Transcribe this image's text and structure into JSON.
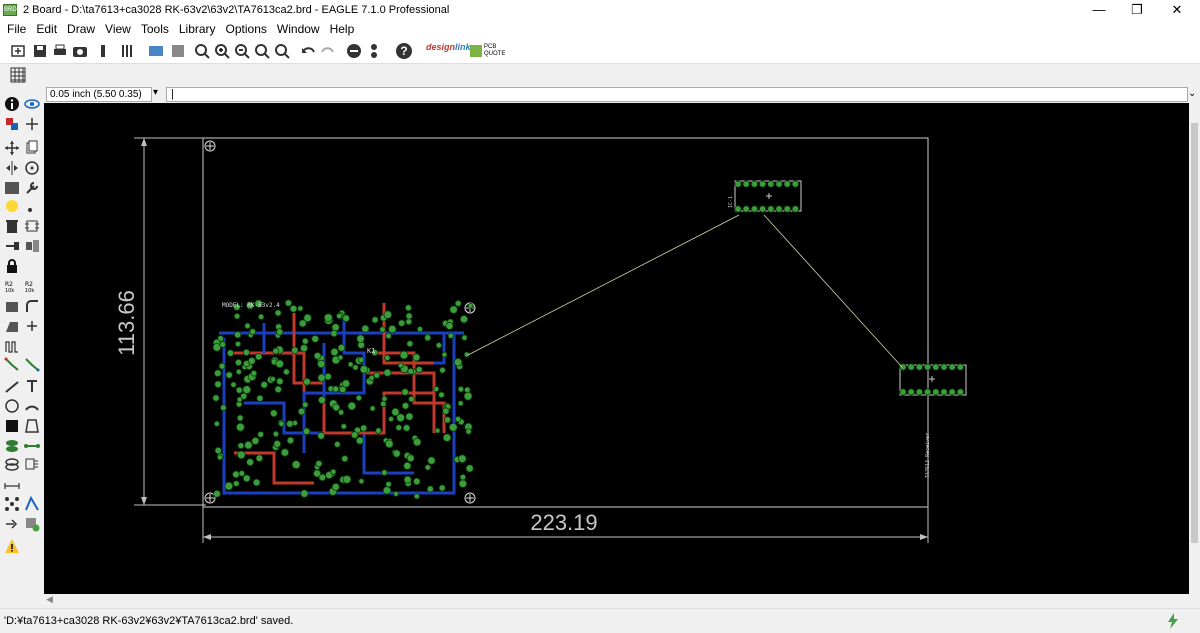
{
  "window": {
    "app_icon_text": "BRD",
    "title": "2 Board - D:\\ta7613+ca3028  RK-63v2\\63v2\\TA7613ca2.brd - EAGLE 7.1.0 Professional",
    "minimize": "—",
    "maximize": "❐",
    "close": "✕"
  },
  "menu": {
    "items": [
      {
        "label": "File"
      },
      {
        "label": "Edit"
      },
      {
        "label": "Draw"
      },
      {
        "label": "View"
      },
      {
        "label": "Tools"
      },
      {
        "label": "Library"
      },
      {
        "label": "Options"
      },
      {
        "label": "Window"
      },
      {
        "label": "Help"
      }
    ]
  },
  "toolbar": {
    "help_glyph": "?",
    "designlink_text": "design",
    "designlink_sub": "link",
    "pcbquote_text": "PCB QUOTE"
  },
  "command": {
    "coordinate_readout": "0.05 inch (5.50 0.35)",
    "command_value": "|"
  },
  "board": {
    "dim_height": "113.66",
    "dim_width": "223.19",
    "model_label": "MODEL: RK-63v2.4",
    "k_label": "K1",
    "side_label": "TA7613 Receiver",
    "ic_label": "IC-1"
  },
  "status": {
    "message": "'D:¥ta7613+ca3028  RK-63v2¥63v2¥TA7613ca2.brd' saved."
  }
}
